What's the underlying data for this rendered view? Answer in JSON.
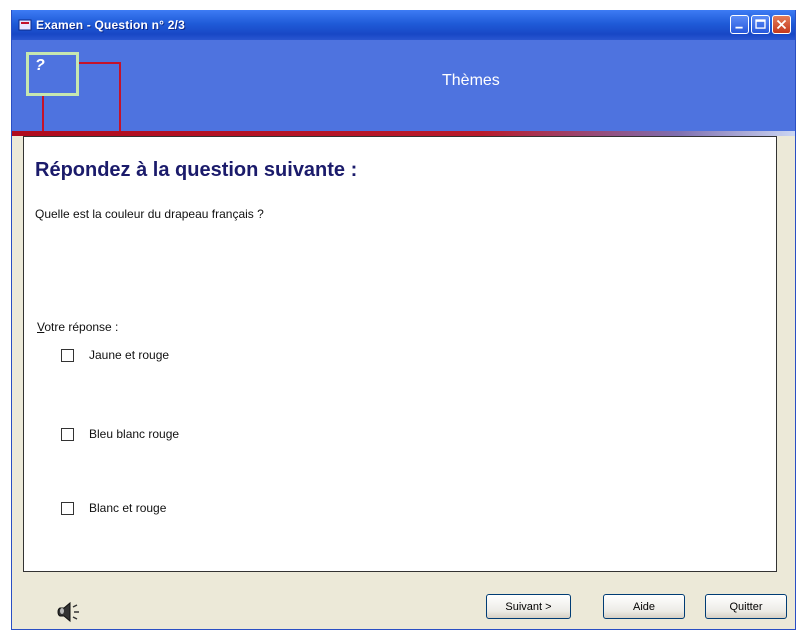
{
  "window": {
    "title": "Examen - Question n° 2/3"
  },
  "banner": {
    "title": "Thèmes",
    "logo_symbol": "?"
  },
  "content": {
    "heading": "Répondez à la question suivante :",
    "question": "Quelle est la couleur du drapeau français ?",
    "answer_label_first": "V",
    "answer_label_rest": "otre réponse :",
    "options": [
      {
        "label": "Jaune et rouge",
        "checked": false
      },
      {
        "label": "Bleu blanc rouge",
        "checked": false
      },
      {
        "label": "Blanc et rouge",
        "checked": false
      }
    ]
  },
  "buttons": {
    "next": "Suivant >",
    "help": "Aide",
    "quit": "Quitter"
  },
  "icons": {
    "speaker": "speaker-icon",
    "app": "app-icon"
  },
  "colors": {
    "banner": "#4e73df",
    "heading": "#1b1b6b",
    "logo_red": "#c4122a",
    "logo_green": "#c6e7b0"
  }
}
